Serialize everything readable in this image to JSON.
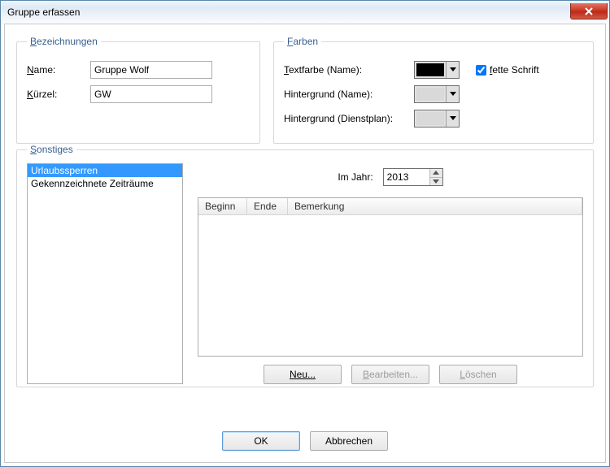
{
  "window": {
    "title": "Gruppe erfassen"
  },
  "bezeichnungen": {
    "legend": "Bezeichnungen",
    "name_label_pre": "N",
    "name_label_rest": "ame:",
    "name_value": "Gruppe Wolf",
    "kuerzel_label_pre": "K",
    "kuerzel_label_rest": "ürzel:",
    "kuerzel_value": "GW"
  },
  "farben": {
    "legend": "Farben",
    "textfarbe_label_pre": "T",
    "textfarbe_label_rest": "extfarbe (Name):",
    "textfarbe_color": "#000000",
    "hgname_label": "Hintergrund (Name):",
    "hgname_color": "#d9d9d9",
    "hgdienst_label": "Hintergrund (Dienstplan):",
    "hgdienst_color": "#d9d9d9",
    "fette_pre": "f",
    "fette_rest": "ette Schrift",
    "fette_checked": true
  },
  "sonstiges": {
    "legend": "Sonstiges",
    "items": [
      "Urlaubssperren",
      "Gekennzeichnete Zeiträume"
    ],
    "imjahr_label": "Im Jahr:",
    "imjahr_value": "2013",
    "cols": {
      "beginn": "Beginn",
      "ende": "Ende",
      "bemerkung": "Bemerkung"
    },
    "neu": "Neu...",
    "bearbeiten_pre": "B",
    "bearbeiten_rest": "earbeiten...",
    "loeschen_pre": "L",
    "loeschen_rest": "öschen"
  },
  "footer": {
    "ok": "OK",
    "abbrechen": "Abbrechen"
  },
  "legend_pre": {
    "bez": "B",
    "bez_rest": "ezeichnungen",
    "farben": "F",
    "farben_rest": "arben",
    "sonst": "S",
    "sonst_rest": "onstiges"
  }
}
